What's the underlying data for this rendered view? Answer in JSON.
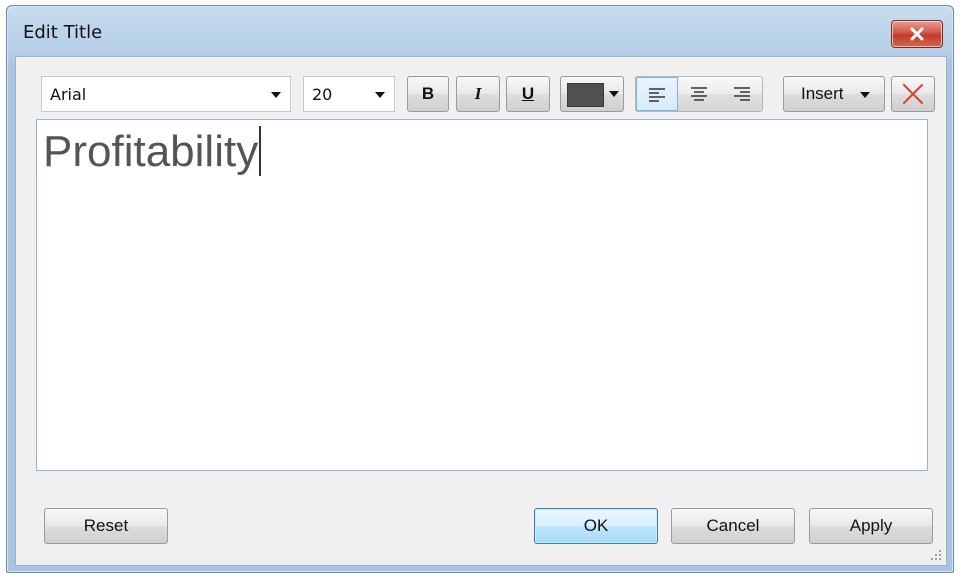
{
  "window": {
    "title": "Edit Title"
  },
  "toolbar": {
    "font_name": "Arial",
    "font_size": "20",
    "bold_label": "B",
    "italic_label": "I",
    "underline_label": "U",
    "font_color": "#505050",
    "alignment_selected": "left",
    "insert_label": "Insert",
    "clear_icon": "red-x-icon"
  },
  "editor": {
    "text": "Profitability"
  },
  "buttons": {
    "reset": "Reset",
    "ok": "OK",
    "cancel": "Cancel",
    "apply": "Apply"
  },
  "colors": {
    "titlebar": "#b3cde6",
    "close_button": "#c94a3b",
    "ok_highlight": "#a7d9f5",
    "clear_x": "#d9463a"
  }
}
